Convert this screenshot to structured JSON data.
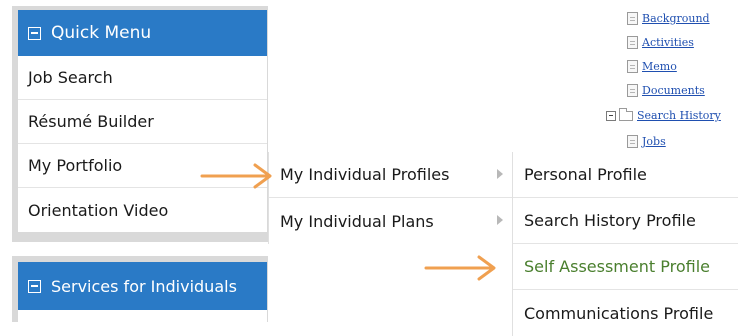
{
  "tree": {
    "items": [
      {
        "label": "Background",
        "icon": "document-icon"
      },
      {
        "label": "Activities",
        "icon": "document-icon"
      },
      {
        "label": "Memo",
        "icon": "document-icon"
      },
      {
        "label": "Documents",
        "icon": "document-icon"
      },
      {
        "label": "Search History",
        "icon": "folder-icon",
        "expanded": true
      },
      {
        "label": "Jobs",
        "icon": "document-icon"
      }
    ]
  },
  "quick_menu": {
    "title": "Quick Menu",
    "items": [
      {
        "label": "Job Search"
      },
      {
        "label": "Résumé Builder"
      },
      {
        "label": "My Portfolio"
      },
      {
        "label": "Orientation Video"
      }
    ]
  },
  "portfolio_submenu": {
    "items": [
      {
        "label": "My Individual Profiles"
      },
      {
        "label": "My Individual Plans"
      }
    ]
  },
  "profiles_submenu": {
    "items": [
      {
        "label": "Personal Profile"
      },
      {
        "label": "Search History Profile"
      },
      {
        "label": "Self Assessment Profile",
        "highlight_color": "#4a7f2e"
      },
      {
        "label": "Communications Profile"
      }
    ]
  },
  "services_menu": {
    "title": "Services for Individuals"
  },
  "colors": {
    "header_blue": "#2a7ac6",
    "arrow_orange": "#f0a050",
    "link_blue": "#1f4fb0"
  }
}
